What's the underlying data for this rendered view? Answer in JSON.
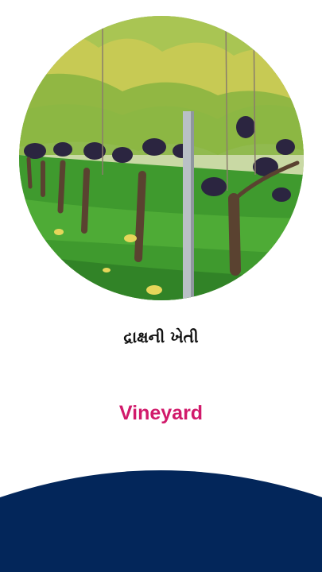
{
  "image": {
    "alt": "vineyard-photo",
    "colors": {
      "sky": "#dfe6d5",
      "leaf": "#9cc04a",
      "leaf_yellow": "#d6c94a",
      "grass": "#3f9a2e",
      "grape": "#2b2540",
      "trunk": "#5a4230",
      "post": "#b9c0c6"
    }
  },
  "title_gujarati": "દ્રાક્ષની ખેતી",
  "title_english": "Vineyard",
  "colors": {
    "accent": "#d11a6b",
    "footer": "#03265a",
    "text": "#111111"
  }
}
